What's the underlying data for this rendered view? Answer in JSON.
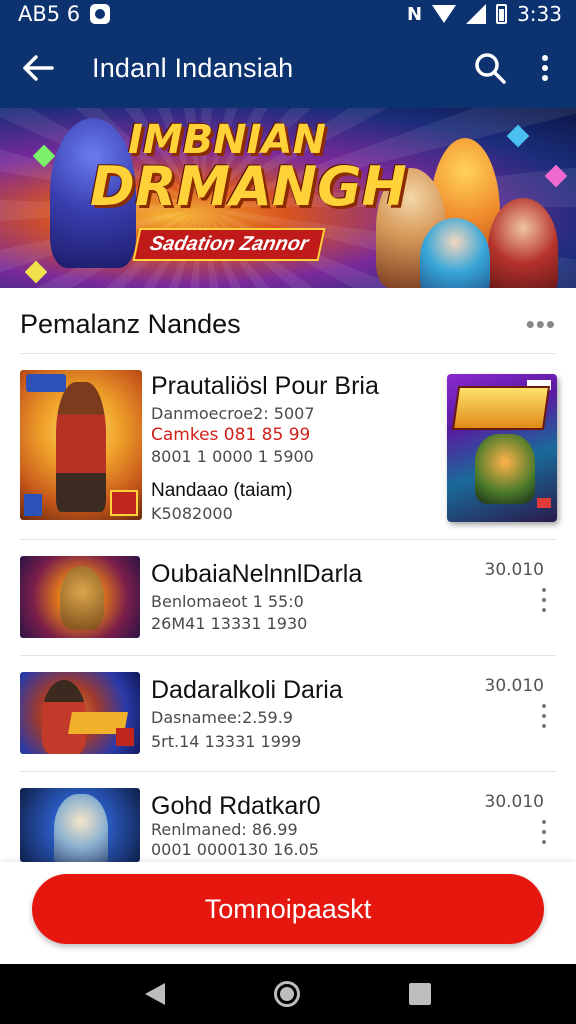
{
  "status_bar": {
    "left_text": "AB5 6",
    "time": "3:33"
  },
  "app_bar": {
    "title": "Indanl Indansiah"
  },
  "banner": {
    "title_line1": "IMBNIAN",
    "title_line2": "DRMANGH",
    "tagline": "Sadation Zannor"
  },
  "section": {
    "title": "Pemalanz Nandes",
    "more": "•••"
  },
  "featured": {
    "title": "Prautaliösl Pour Bria",
    "line1": "Danmoecroe2: 5007",
    "line2_red": "Camkes 081 85 99",
    "line3": "8001 1 0000 1 5900",
    "line4": "Nandaao (taiam)",
    "line5": "K5082000"
  },
  "games": [
    {
      "title": "OubaiaNelnnlDarla",
      "line1": "Benlomaeot 1 55:0",
      "line2": "26M41 13331 1930",
      "price": "30.010"
    },
    {
      "title": "Dadaralkoli Daria",
      "line1": "Dasnamee:2.59.9",
      "line2": "5rt.14 13331 1999",
      "price": "30.010"
    },
    {
      "title": "Gohd Rdatkar0",
      "line1": "Renlmaned: 86.99",
      "line2": "0001 0000130 16.05",
      "price": "30.010"
    }
  ],
  "cta": {
    "label": "Tomnoipaaskt"
  },
  "colors": {
    "app_bar": "#0d3270",
    "cta": "#e5170f",
    "price_red": "#d0201a"
  }
}
